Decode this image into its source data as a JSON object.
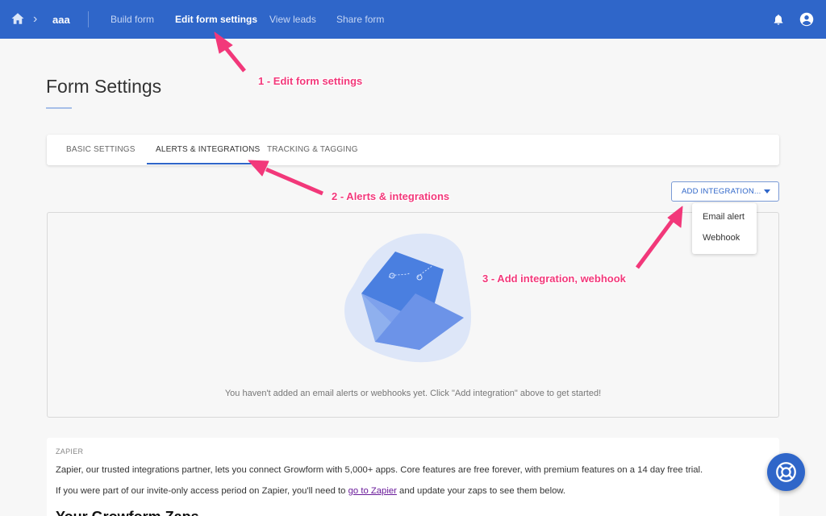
{
  "nav": {
    "project": "aaa",
    "links": [
      "Build form",
      "Edit form settings",
      "View leads",
      "Share form"
    ],
    "active_link": "Edit form settings",
    "icons": [
      "home-icon",
      "chevron-right-icon",
      "bell-icon",
      "account-icon"
    ]
  },
  "page": {
    "title": "Form Settings"
  },
  "tabs": {
    "items": [
      "BASIC SETTINGS",
      "ALERTS & INTEGRATIONS",
      "TRACKING & TAGGING"
    ],
    "active": "ALERTS & INTEGRATIONS"
  },
  "integration": {
    "add_button": "ADD INTEGRATION...",
    "dropdown_items": [
      "Email alert",
      "Webhook"
    ]
  },
  "empty_state": {
    "message": "You haven't added an email alerts or webhooks yet. Click \"Add integration\" above to get started!"
  },
  "zapier": {
    "label": "ZAPIER",
    "paragraph1": "Zapier, our trusted integrations partner, lets you connect Growform with 5,000+ apps. Core features are free forever, with premium features on a 14 day free trial.",
    "paragraph2_before": "If you were part of our invite-only access period on Zapier, you'll need to ",
    "paragraph2_link": "go to Zapier",
    "paragraph2_after": " and update your zaps to see them below.",
    "heading": "Your Growform Zaps"
  },
  "annotations": {
    "step1": "1 - Edit form settings",
    "step2": "2 - Alerts & integrations",
    "step3": "3 - Add integration, webhook",
    "color": "#f2387a"
  },
  "colors": {
    "primary": "#2f66c9",
    "annotation": "#f2387a"
  }
}
